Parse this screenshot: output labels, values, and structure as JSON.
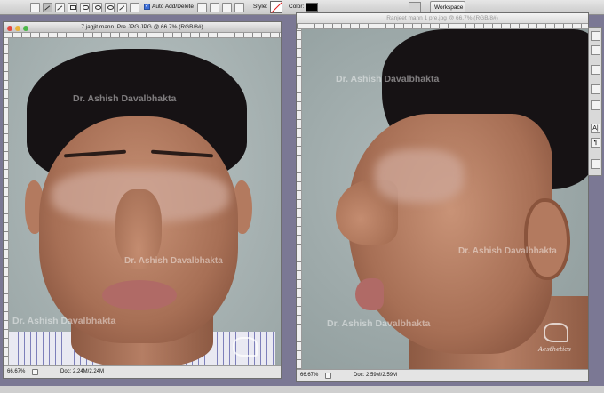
{
  "options_bar": {
    "auto_add_delete_label": "Auto Add/Delete",
    "style_label": "Style:",
    "color_label": "Color:",
    "workspace_label": "Workspace"
  },
  "doc_left": {
    "title": "7 jagjit mann. Pre JPG.JPG @ 66.7% (RGB/8#)",
    "zoom": "66.67%",
    "doc_size": "Doc: 2.24M/2.24M",
    "watermark_top": "Dr. Ashish Davalbhakta",
    "watermark_mid": "Dr. Ashish Davalbhakta",
    "watermark_bottom": "Dr. Ashish Davalbhakta"
  },
  "doc_right": {
    "title": "Ranjeet mann 1 pre.jpg @ 66.7% (RGB/8#)",
    "zoom": "66.67%",
    "doc_size": "Doc: 2.59M/2.59M",
    "watermark_top": "Dr. Ashish Davalbhakta",
    "watermark_mid": "Dr. Ashish Davalbhakta",
    "watermark_bottom": "Dr. Ashish Davalbhakta",
    "logo_text": "Aesthetics"
  },
  "tool_panel": {
    "text_tool_glyph": "A|",
    "paragraph_glyph": "¶"
  }
}
